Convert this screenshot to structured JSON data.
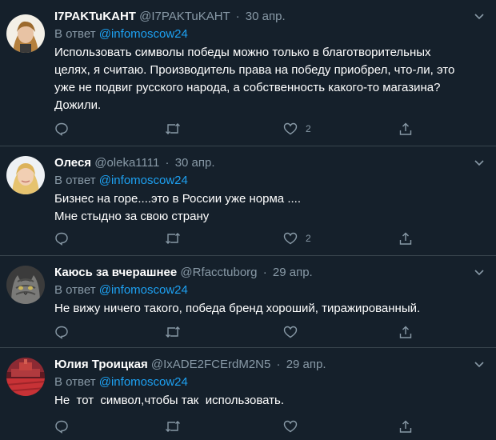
{
  "tweets": [
    {
      "name": "I7PAKTuKAHT",
      "handle": "@I7PAKTuKAHT",
      "date": "30 апр.",
      "reply_prefix": "В ответ",
      "reply_to": "@infomoscow24",
      "lines": [
        "Использовать символы победы можно только в благотворительных",
        "целях, я считаю. Производитель права на победу приобрел, что-ли, это",
        "уже не подвиг русского народа, а собственность какого-то магазина?",
        "Дожили."
      ],
      "like_count": "2",
      "avatar": "woman-portrait-blonde"
    },
    {
      "name": "Олеся",
      "handle": "@oleka1111",
      "date": "30 апр.",
      "reply_prefix": "В ответ",
      "reply_to": "@infomoscow24",
      "lines": [
        "Бизнес на горе....это в России уже норма ....",
        "Мне стыдно за свою страну"
      ],
      "like_count": "2",
      "avatar": "woman-portrait-blonde-2"
    },
    {
      "name": "Каюсь за вчерашнее",
      "handle": "@Rfacctuborg",
      "date": "29 апр.",
      "reply_prefix": "В ответ",
      "reply_to": "@infomoscow24",
      "lines": [
        "Не вижу ничего такого, победа бренд хороший, тиражированный."
      ],
      "like_count": "",
      "avatar": "cat-photo"
    },
    {
      "name": "Юлия Троицкая",
      "handle": "@IxADE2FCErdM2N5",
      "date": "29 апр.",
      "reply_prefix": "В ответ",
      "reply_to": "@infomoscow24",
      "lines": [
        "Не  тот  символ,чтобы так  использовать."
      ],
      "like_count": "",
      "avatar": "red-square-photo"
    }
  ],
  "icons": {
    "reply": "reply-icon",
    "retweet": "retweet-icon",
    "like": "heart-icon",
    "share": "share-icon",
    "more": "chevron-down-icon"
  },
  "colors": {
    "background": "#15202b",
    "text": "#ffffff",
    "secondary": "#8899a6",
    "link": "#1da1f2",
    "divider": "#38444d"
  }
}
